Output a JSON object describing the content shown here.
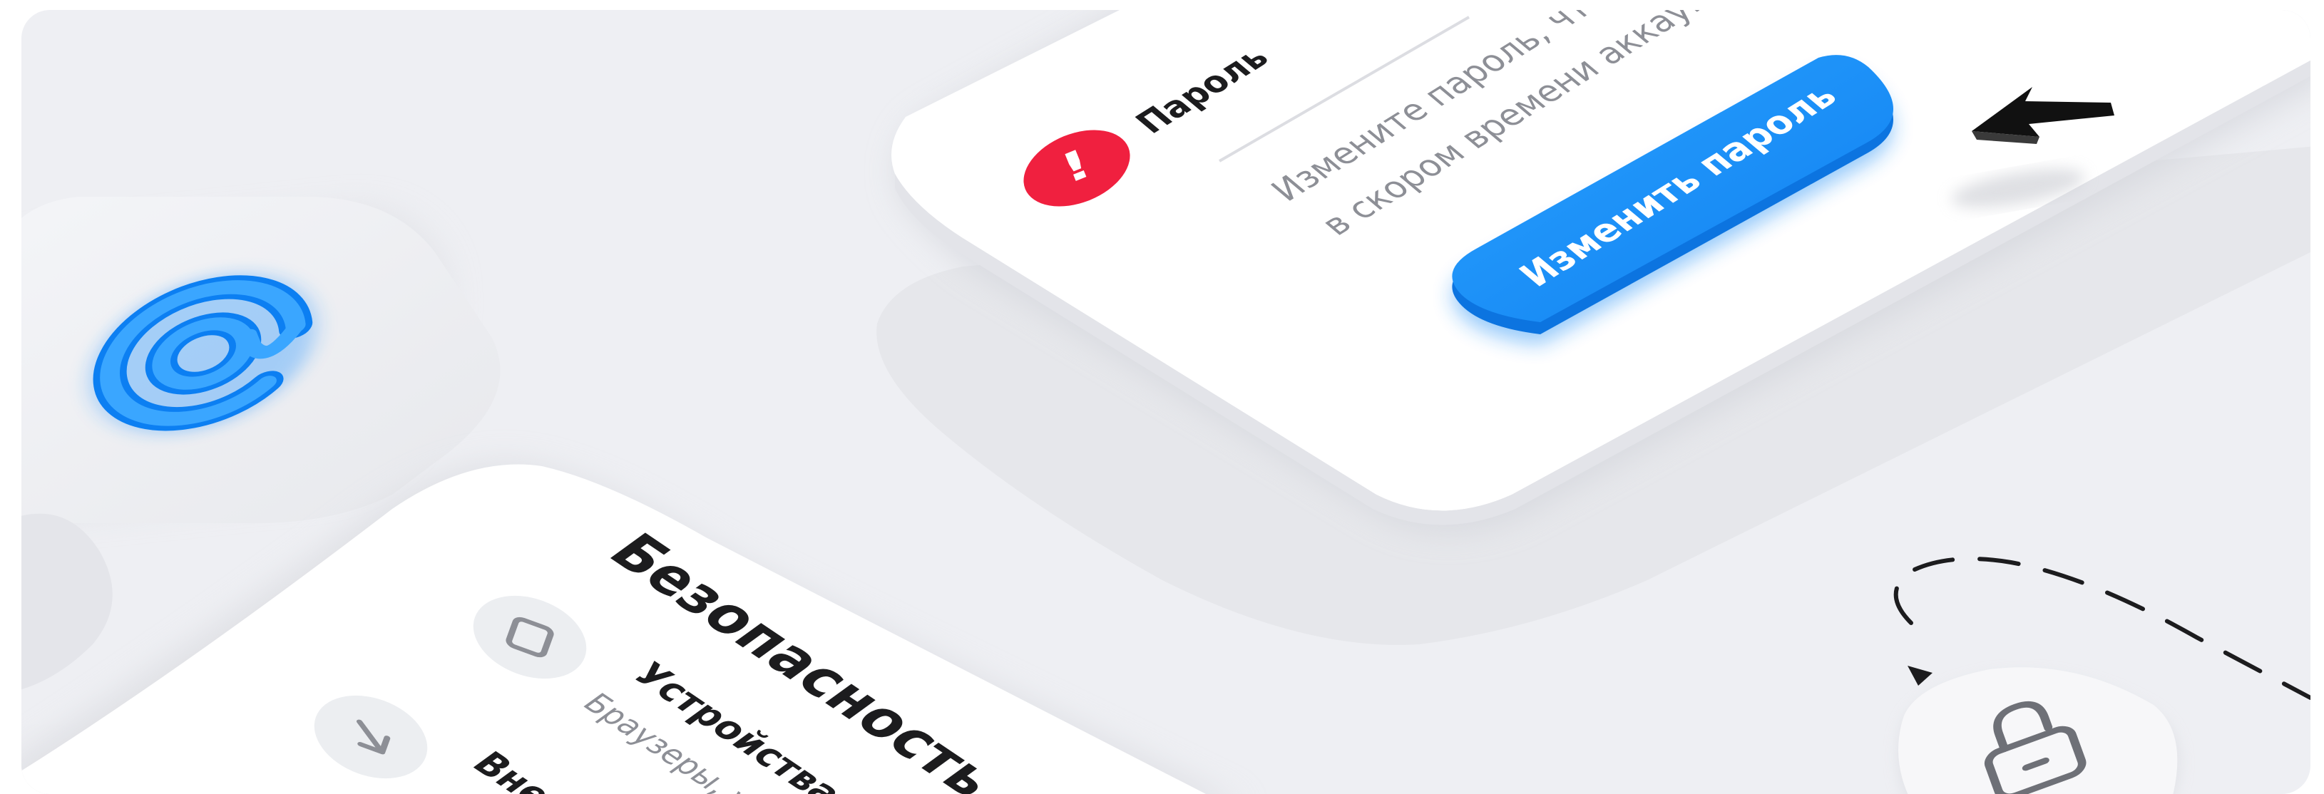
{
  "password_card": {
    "title": "Пароль",
    "description_line1": "Измените пароль, чтобы",
    "description_line2": "в скором времени аккаунт",
    "button_label": "Изменить пароль",
    "alert_glyph": "!"
  },
  "security_card": {
    "title": "Безопасность",
    "item1_title": "Устройства и",
    "item1_subtitle": "Браузеры, у",
    "item2_title": "Вне"
  },
  "icons": {
    "mail": "at-sign-icon",
    "lock": "lock-icon",
    "cursor": "cursor-arrow-icon",
    "device": "device-icon",
    "arrow": "arrow-down-right-icon"
  },
  "colors": {
    "accent_blue": "#1b8cf5",
    "alert_red": "#f0203f",
    "background": "#eeeff3",
    "card": "#ffffff"
  }
}
